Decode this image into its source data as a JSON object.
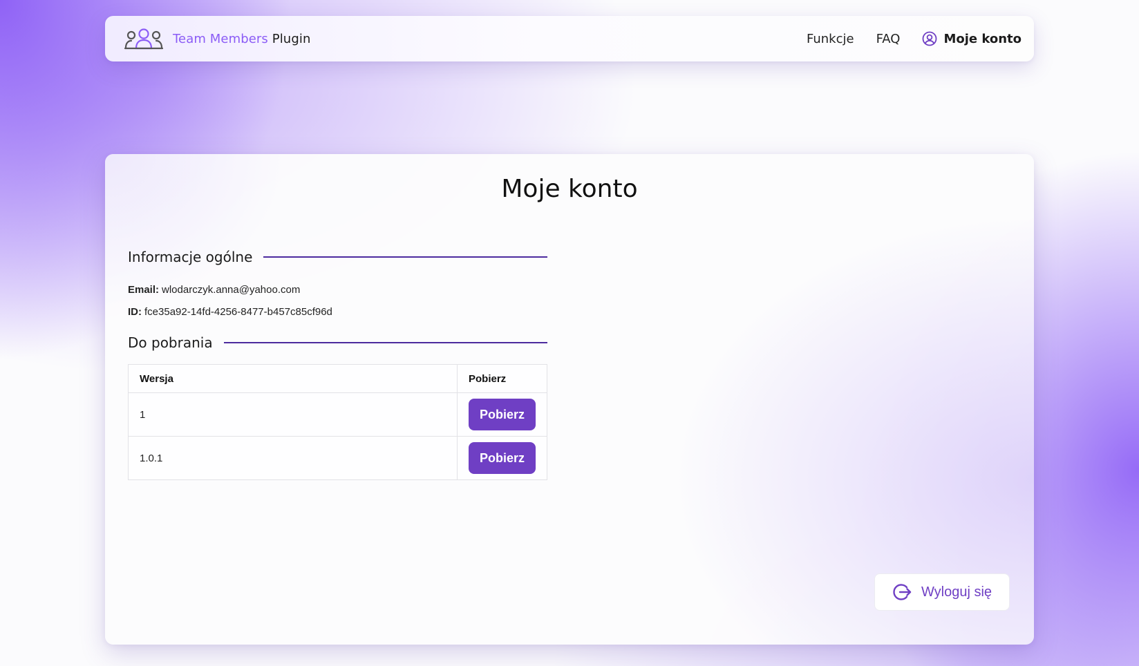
{
  "nav": {
    "brand_part1": "Team Members",
    "brand_part2": "Plugin",
    "logo_icon": "team-members-icon",
    "links": [
      {
        "label": "Funkcje"
      },
      {
        "label": "FAQ"
      }
    ],
    "account_label": "Moje konto",
    "account_icon": "user-circle-icon"
  },
  "page": {
    "title": "Moje konto"
  },
  "general": {
    "heading": "Informacje ogólne",
    "email_label": "Email:",
    "email_value": "wlodarczyk.anna@yahoo.com",
    "id_label": "ID:",
    "id_value": "fce35a92-14fd-4256-8477-b457c85cf96d"
  },
  "downloads": {
    "heading": "Do pobrania",
    "columns": [
      "Wersja",
      "Pobierz"
    ],
    "rows": [
      {
        "version": "1",
        "button_label": "Pobierz"
      },
      {
        "version": "1.0.1",
        "button_label": "Pobierz"
      }
    ]
  },
  "logout": {
    "label": "Wyloguj się",
    "icon": "logout-icon"
  },
  "colors": {
    "accent": "#6f3fc4",
    "brand_purple": "#8b5cf6",
    "rule": "#4c2a9e"
  }
}
